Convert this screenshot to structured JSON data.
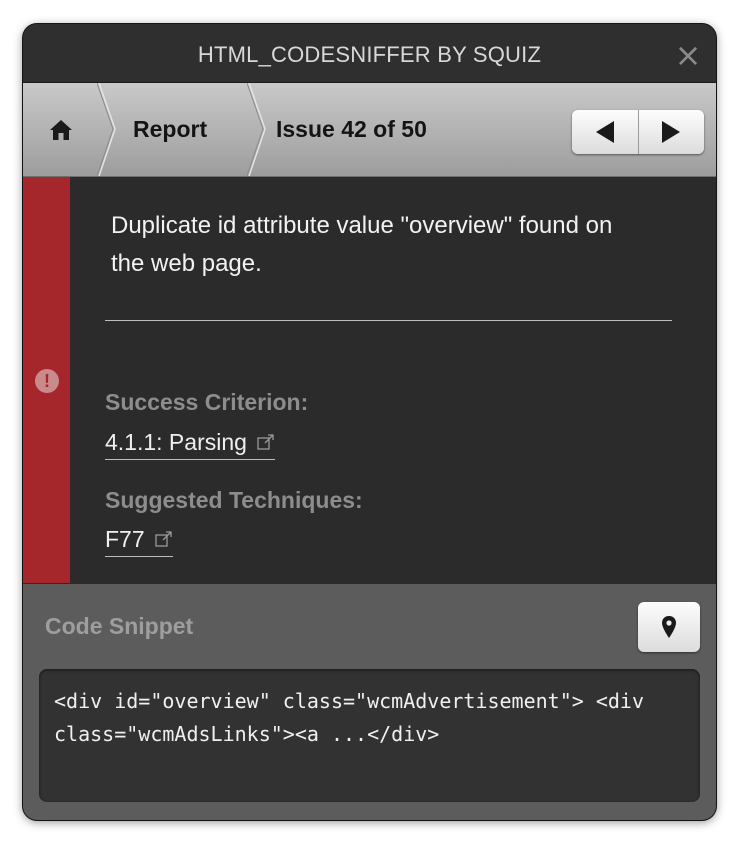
{
  "window": {
    "title": "HTML_CODESNIFFER BY SQUIZ",
    "close_icon": "close-icon"
  },
  "nav": {
    "home_icon": "home-icon",
    "crumb_report": "Report",
    "crumb_issue": "Issue 42 of 50",
    "prev_icon": "triangle-left-icon",
    "next_icon": "triangle-right-icon"
  },
  "issue": {
    "severity": "error",
    "severity_color": "#a5262b",
    "message": "Duplicate id attribute value \"overview\" found on the web page.",
    "success_criterion_label": "Success Criterion:",
    "success_criterion_link": "4.1.1: Parsing",
    "techniques_label": "Suggested Techniques:",
    "technique_link": "F77"
  },
  "snippet": {
    "title": "Code Snippet",
    "pin_icon": "map-pin-icon",
    "code": "<div id=\"overview\" class=\"wcmAdvertisement\"> <div class=\"wcmAdsLinks\"><a ...</div>"
  }
}
